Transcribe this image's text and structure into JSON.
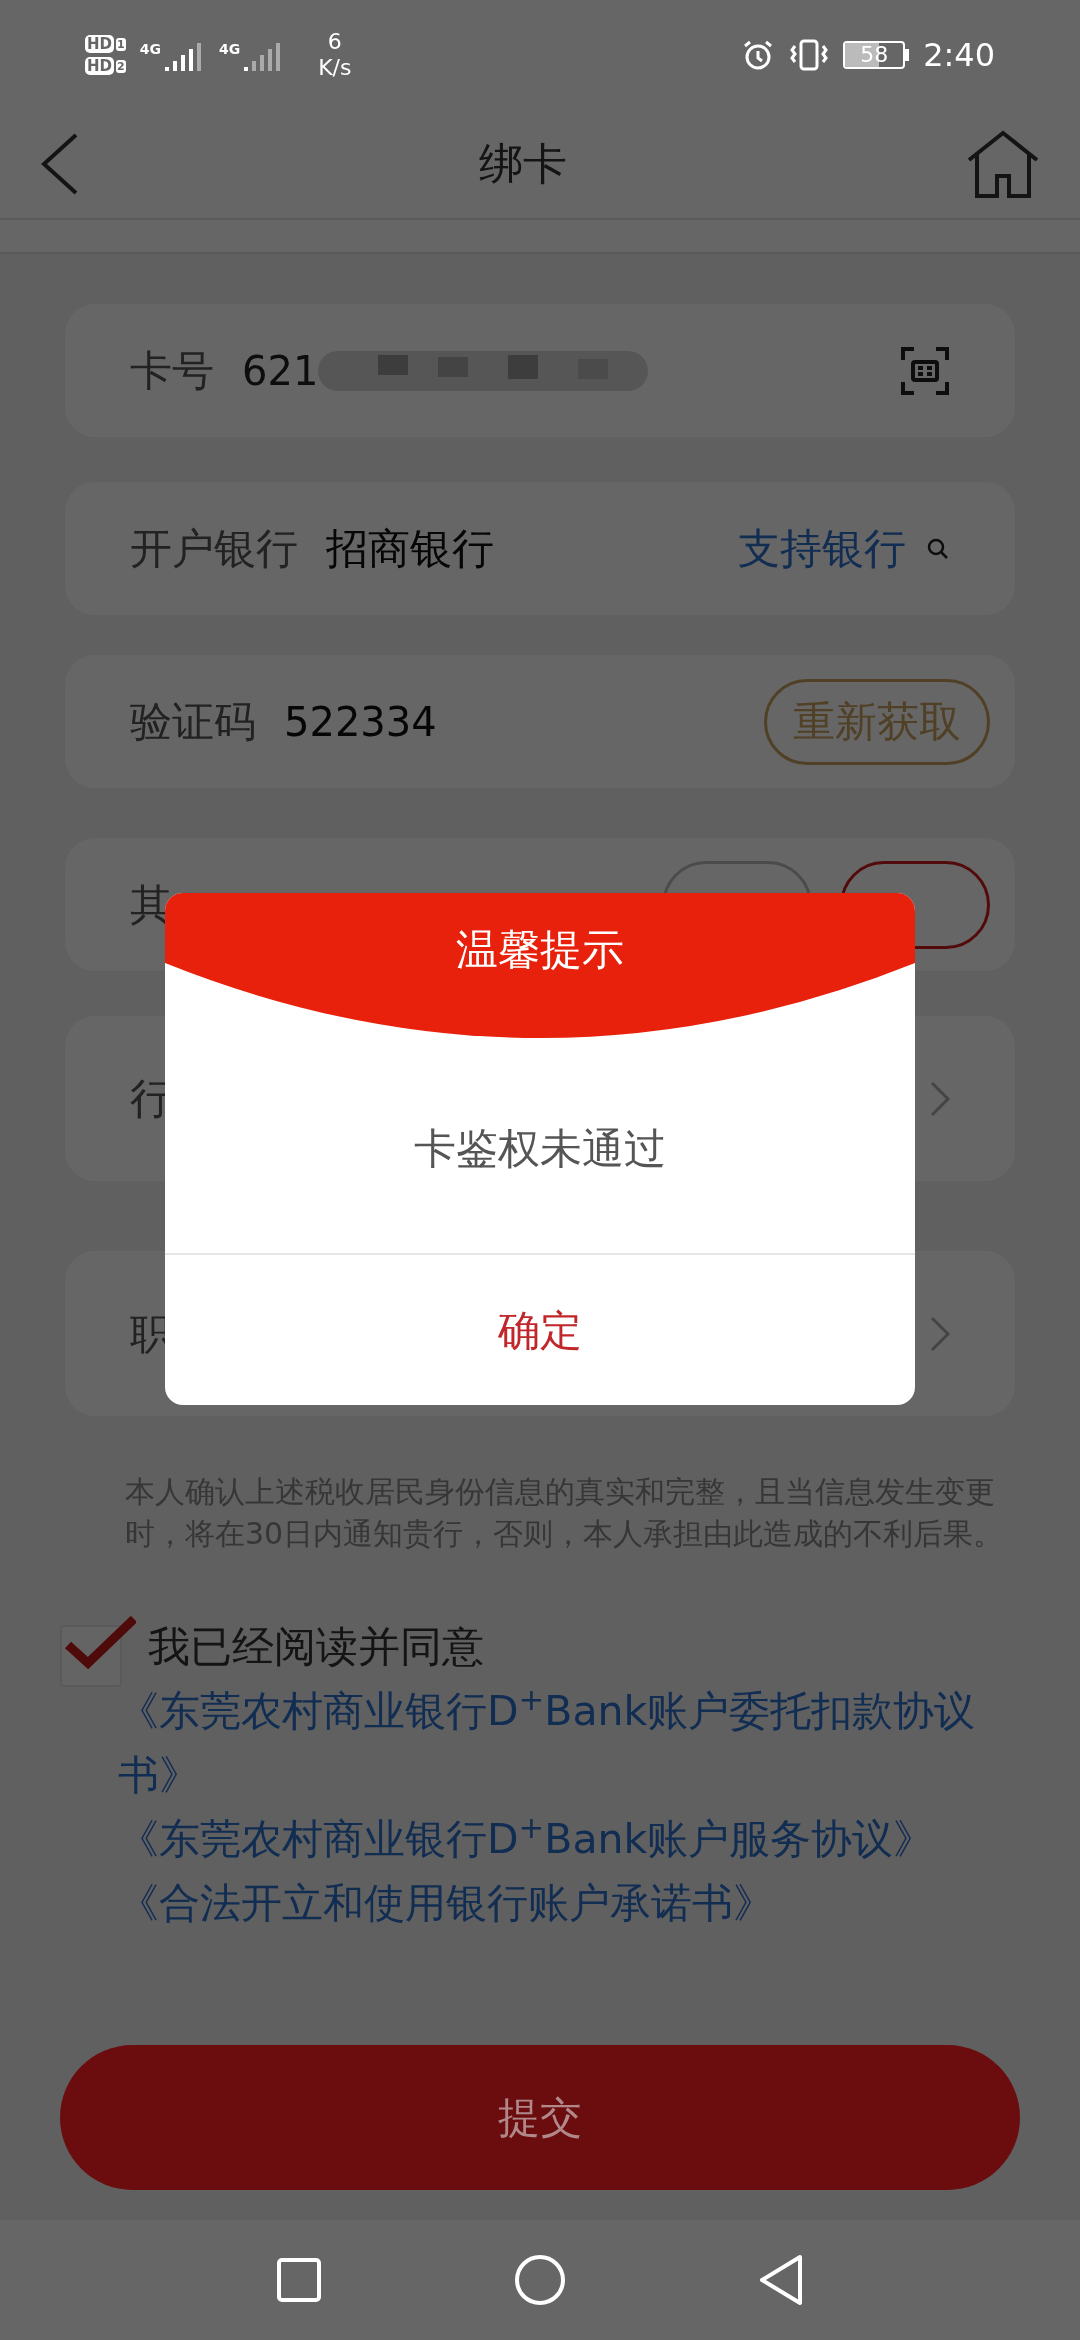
{
  "status_bar": {
    "sims": [
      {
        "label": "HD",
        "index": "1",
        "network": "4G"
      },
      {
        "label": "HD",
        "index": "2",
        "network": "4G"
      }
    ],
    "speed": "6",
    "speed_unit": "K/s",
    "battery": "58",
    "time": "2:40"
  },
  "header": {
    "title": "绑卡"
  },
  "form": [
    {
      "kind": "card",
      "label": "卡号",
      "value": "621"
    },
    {
      "kind": "bank",
      "label": "开户银行",
      "value": "招商银行",
      "link": "支持银行"
    },
    {
      "kind": "code",
      "label": "验证码",
      "value": "522334",
      "button": "重新获取"
    },
    {
      "kind": "choice",
      "label": "其",
      "options": [
        {
          "selected": false
        },
        {
          "selected": true
        }
      ]
    },
    {
      "kind": "select",
      "label": "行"
    },
    {
      "kind": "select",
      "label": "职"
    }
  ],
  "disclaimer": "本人确认上述税收居民身份信息的真实和完整，且当信息发生变更时，将在30日内通知贵行，否则，本人承担由此造成的不利后果。",
  "agreement": {
    "checked": true,
    "label": "我已经阅读并同意",
    "links": [
      "《东莞农村商业银行D$^{+}$Bank账户委托扣款协议书》",
      "《东莞农村商业银行D$^{+}$Bank账户服务协议》",
      "《合法开立和使用银行账户承诺书》"
    ]
  },
  "submit": "提交",
  "dialog": {
    "title": "温馨提示",
    "message": "卡鉴权未通过",
    "button": "确定"
  }
}
